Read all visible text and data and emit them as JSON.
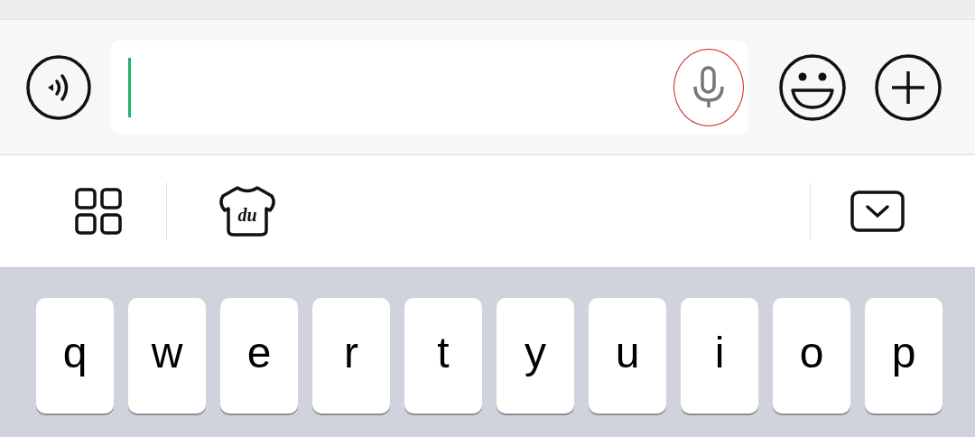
{
  "input_bar": {
    "cursor_visible": true,
    "mic_highlighted": true
  },
  "toolbar": {
    "skin_label": "du"
  },
  "keyboard": {
    "keys": [
      "q",
      "w",
      "e",
      "r",
      "t",
      "y",
      "u",
      "i",
      "o",
      "p"
    ]
  }
}
